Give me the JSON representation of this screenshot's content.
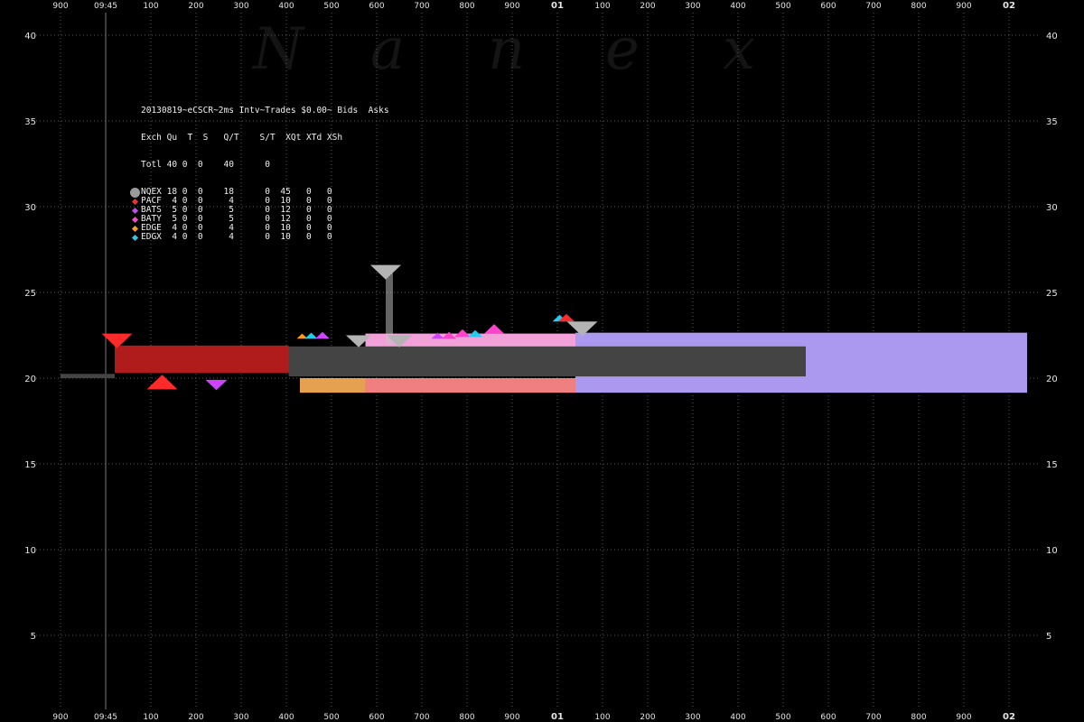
{
  "watermark_letters": [
    "N",
    "a",
    "n",
    "e",
    "x"
  ],
  "legend": {
    "title": "20130819~eCSCR~2ms Intv~Trades $0.00~ Bids  Asks",
    "header": "Exch Qu  T  S   Q/T    S/T  XQt XTd XSh",
    "total_row": "Totl 40 0  0    40      0",
    "rows": [
      {
        "marker": "circle",
        "color": "#9a9a9a",
        "text": "NQEX 18 0  0    18      0  45   0   0"
      },
      {
        "marker": "diamond",
        "color": "#ff2a2a",
        "text": "PACF  4 0  0     4      0  10   0   0"
      },
      {
        "marker": "diamond",
        "color": "#cc44ff",
        "text": "BATS  5 0  0     5      0  12   0   0"
      },
      {
        "marker": "diamond",
        "color": "#ff44cc",
        "text": "BATY  5 0  0     5      0  12   0   0"
      },
      {
        "marker": "diamond",
        "color": "#ff9a1a",
        "text": "EDGE  4 0  0     4      0  10   0   0"
      },
      {
        "marker": "diamond",
        "color": "#22ccee",
        "text": "EDGX  4 0  0     4      0  10   0   0"
      }
    ]
  },
  "chart_data": {
    "type": "area",
    "title": "20130819~eCSCR~2ms Intv~Trades $0.00~ Bids  Asks",
    "xlabel": "",
    "ylabel": "",
    "ylim": [
      0,
      42
    ],
    "yticks": [
      5,
      10,
      15,
      20,
      25,
      30,
      35,
      40
    ],
    "grid": true,
    "legend_position": "top-left",
    "x_ticks": [
      {
        "label": "900",
        "ms": 900,
        "bold": false
      },
      {
        "label": "09:45",
        "ms": 1000,
        "bold": false
      },
      {
        "label": "100",
        "ms": 1100,
        "bold": false
      },
      {
        "label": "200",
        "ms": 1200,
        "bold": false
      },
      {
        "label": "300",
        "ms": 1300,
        "bold": false
      },
      {
        "label": "400",
        "ms": 1400,
        "bold": false
      },
      {
        "label": "500",
        "ms": 1500,
        "bold": false
      },
      {
        "label": "600",
        "ms": 1600,
        "bold": false
      },
      {
        "label": "700",
        "ms": 1700,
        "bold": false
      },
      {
        "label": "800",
        "ms": 1800,
        "bold": false
      },
      {
        "label": "900",
        "ms": 1900,
        "bold": false
      },
      {
        "label": "01",
        "ms": 2000,
        "bold": true
      },
      {
        "label": "100",
        "ms": 2100,
        "bold": false
      },
      {
        "label": "200",
        "ms": 2200,
        "bold": false
      },
      {
        "label": "300",
        "ms": 2300,
        "bold": false
      },
      {
        "label": "400",
        "ms": 2400,
        "bold": false
      },
      {
        "label": "500",
        "ms": 2500,
        "bold": false
      },
      {
        "label": "600",
        "ms": 2600,
        "bold": false
      },
      {
        "label": "700",
        "ms": 2700,
        "bold": false
      },
      {
        "label": "800",
        "ms": 2800,
        "bold": false
      },
      {
        "label": "900",
        "ms": 2900,
        "bold": false
      },
      {
        "label": "02",
        "ms": 3000,
        "bold": true
      }
    ],
    "bands": [
      {
        "name": "NQEX",
        "color": "#444444",
        "x0": 900,
        "x1": 1020,
        "y0": 20.0,
        "y1": 20.25
      },
      {
        "name": "PACF",
        "color": "#b01c1c",
        "x0": 1020,
        "x1": 1405,
        "y0": 20.3,
        "y1": 21.9
      },
      {
        "name": "EDGE",
        "color": "#e5a050",
        "x0": 1430,
        "x1": 1575,
        "y0": 19.15,
        "y1": 20.0
      },
      {
        "name": "PACF",
        "color": "#f08080",
        "x0": 1575,
        "x1": 2040,
        "y0": 19.15,
        "y1": 20.0
      },
      {
        "name": "BATY",
        "color": "#f2a0d8",
        "x0": 1575,
        "x1": 2040,
        "y0": 21.8,
        "y1": 22.6
      },
      {
        "name": "EDGX",
        "color": "#aa99ee",
        "x0": 2040,
        "x1": 3040,
        "y0": 19.15,
        "y1": 22.65
      },
      {
        "name": "NQEX",
        "color": "#444444",
        "x0": 1405,
        "x1": 2550,
        "y0": 20.1,
        "y1": 21.85
      }
    ],
    "triangles": [
      {
        "name": "PACF",
        "color": "#ff2a2a",
        "x": 1025,
        "y": 22.6,
        "dir": "down",
        "w": 17
      },
      {
        "name": "PACF",
        "color": "#ff2a2a",
        "x": 1125,
        "y": 19.35,
        "dir": "up",
        "w": 17
      },
      {
        "name": "BATS",
        "color": "#cc44ff",
        "x": 1245,
        "y": 19.9,
        "dir": "down",
        "w": 12
      },
      {
        "name": "NQEX",
        "color": "#b4b4b4",
        "x": 1620,
        "y": 26.6,
        "dir": "down",
        "w": 17
      },
      {
        "name": "EDGE",
        "color": "#ff9a1a",
        "x": 1435,
        "y": 22.3,
        "dir": "up",
        "w": 6
      },
      {
        "name": "EDGX",
        "color": "#22ccee",
        "x": 1455,
        "y": 22.3,
        "dir": "up",
        "w": 7
      },
      {
        "name": "BATS",
        "color": "#cc44ff",
        "x": 1480,
        "y": 22.3,
        "dir": "up",
        "w": 8
      },
      {
        "name": "NQEX",
        "color": "#b4b4b4",
        "x": 1560,
        "y": 22.5,
        "dir": "down",
        "w": 14
      },
      {
        "name": "NQEX",
        "color": "#b4b4b4",
        "x": 1650,
        "y": 22.5,
        "dir": "down",
        "w": 14
      },
      {
        "name": "BATS",
        "color": "#cc44ff",
        "x": 1735,
        "y": 22.3,
        "dir": "up",
        "w": 7
      },
      {
        "name": "BATY",
        "color": "#ff44cc",
        "x": 1760,
        "y": 22.3,
        "dir": "up",
        "w": 8
      },
      {
        "name": "BATY",
        "color": "#ff44cc",
        "x": 1790,
        "y": 22.4,
        "dir": "up",
        "w": 9
      },
      {
        "name": "EDGX",
        "color": "#22ccee",
        "x": 1818,
        "y": 22.4,
        "dir": "up",
        "w": 8
      },
      {
        "name": "BATY",
        "color": "#ff44cc",
        "x": 1860,
        "y": 22.6,
        "dir": "up",
        "w": 11
      },
      {
        "name": "EDGX",
        "color": "#22ccee",
        "x": 2005,
        "y": 23.3,
        "dir": "up",
        "w": 8
      },
      {
        "name": "PACF",
        "color": "#ff2a2a",
        "x": 2020,
        "y": 23.3,
        "dir": "up",
        "w": 9
      },
      {
        "name": "NQEX",
        "color": "#b4b4b4",
        "x": 2055,
        "y": 23.3,
        "dir": "down",
        "w": 17
      }
    ],
    "spikes": [
      {
        "x": 1622,
        "y0": 22.0,
        "y1": 26.4
      },
      {
        "x": 1626,
        "y0": 22.0,
        "y1": 26.4
      },
      {
        "x": 1630,
        "y0": 22.0,
        "y1": 26.4
      },
      {
        "x": 1634,
        "y0": 22.0,
        "y1": 26.4
      }
    ],
    "colors": {
      "grid": "#5a5a5a",
      "axis_text": "#e6e6e6",
      "background": "#000000"
    }
  }
}
